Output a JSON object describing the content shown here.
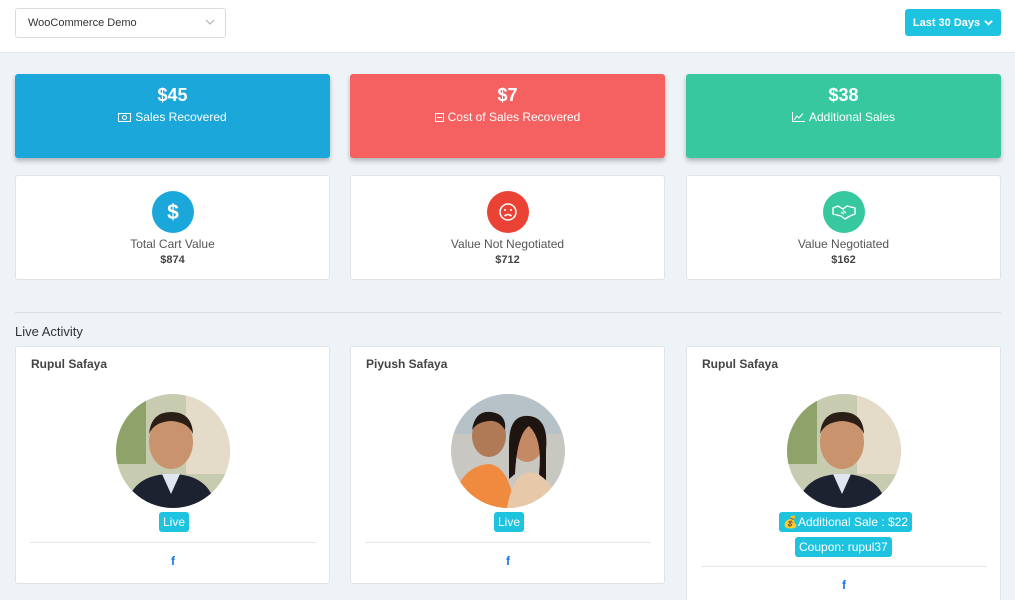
{
  "header": {
    "store_select_value": "WooCommerce Demo",
    "date_range_label": "Last 30 Days"
  },
  "stats": [
    {
      "amount": "$45",
      "label": "Sales Recovered",
      "icon": "money-icon",
      "color": "#1ca7db"
    },
    {
      "amount": "$7",
      "label": "Cost of Sales Recovered",
      "icon": "minus-square-icon",
      "color": "#f56161"
    },
    {
      "amount": "$38",
      "label": "Additional Sales",
      "icon": "line-chart-icon",
      "color": "#38c8a0"
    }
  ],
  "values": [
    {
      "name": "Total Cart Value",
      "amount": "$874",
      "icon": "dollar-icon",
      "color": "#1ca7db"
    },
    {
      "name": "Value Not Negotiated",
      "amount": "$712",
      "icon": "frown-icon",
      "color": "#ea4335"
    },
    {
      "name": "Value Negotiated",
      "amount": "$162",
      "icon": "handshake-icon",
      "color": "#38c8a0"
    }
  ],
  "live_activity": {
    "title": "Live Activity",
    "cards": [
      {
        "user": "Rupul Safaya",
        "badges": [
          "Live"
        ],
        "social_icon": "facebook-icon"
      },
      {
        "user": "Piyush Safaya",
        "badges": [
          "Live"
        ],
        "social_icon": "facebook-icon"
      },
      {
        "user": "Rupul Safaya",
        "badges": [
          "💰Additional Sale : $22",
          "Coupon: rupul37"
        ],
        "social_icon": "facebook-icon"
      }
    ]
  },
  "colors": {
    "accent": "#1ec3e0",
    "facebook": "#1b74e4"
  }
}
